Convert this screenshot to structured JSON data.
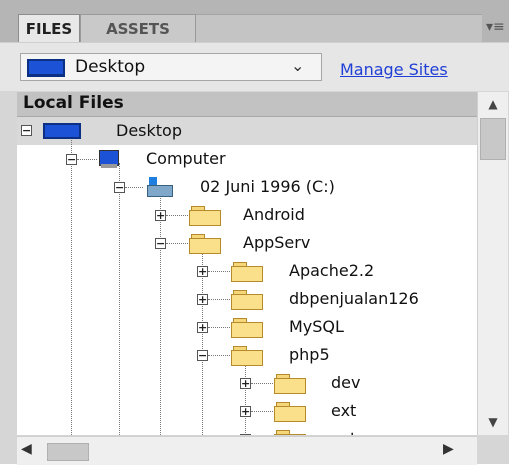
{
  "tabs": {
    "files": "FILES",
    "assets": "ASSETS"
  },
  "toolbar": {
    "site": "Desktop",
    "manage": "Manage Sites"
  },
  "list": {
    "header": "Local Files"
  },
  "tree": {
    "desktop": "Desktop",
    "computer": "Computer",
    "drive": "02 Juni 1996 (C:)",
    "android": "Android",
    "appserv": "AppServ",
    "apache": "Apache2.2",
    "dbpenjualan": "dbpenjualan126",
    "mysql": "MySQL",
    "php5": "php5",
    "dev": "dev",
    "ext": "ext",
    "extras": "extras"
  },
  "colors": {
    "folder": "#fbe08c",
    "link": "#1f3fd6",
    "monitor": "#1c53d6"
  }
}
